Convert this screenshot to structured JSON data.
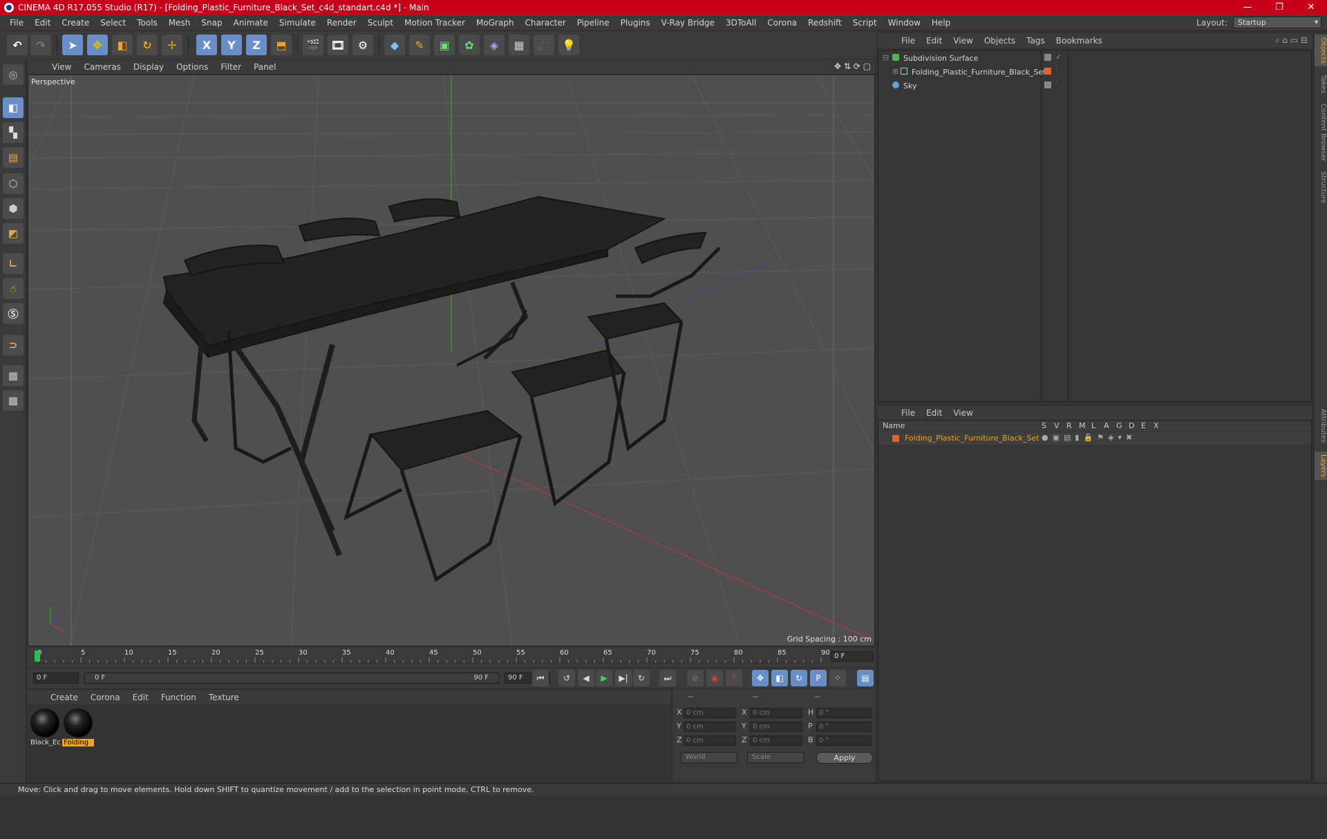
{
  "window": {
    "title": "CINEMA 4D R17.055 Studio (R17) - [Folding_Plastic_Furniture_Black_Set_c4d_standart.c4d *] - Main",
    "controls": [
      "—",
      "❐",
      "✕"
    ]
  },
  "menubar": {
    "items": [
      "File",
      "Edit",
      "Create",
      "Select",
      "Tools",
      "Mesh",
      "Snap",
      "Animate",
      "Simulate",
      "Render",
      "Sculpt",
      "Motion Tracker",
      "MoGraph",
      "Character",
      "Pipeline",
      "Plugins",
      "V-Ray Bridge",
      "3DToAll",
      "Corona",
      "Redshift",
      "Script",
      "Window",
      "Help"
    ],
    "layout_label": "Layout:",
    "layout_value": "Startup"
  },
  "toolbar": {
    "axis_x": "X",
    "axis_y": "Y",
    "axis_z": "Z"
  },
  "viewport": {
    "menu": [
      "View",
      "Cameras",
      "Display",
      "Options",
      "Filter",
      "Panel"
    ],
    "camera_label": "Perspective",
    "grid_spacing": "Grid Spacing : 100 cm"
  },
  "timeline": {
    "ticks": [
      "0",
      "5",
      "10",
      "15",
      "20",
      "25",
      "30",
      "35",
      "40",
      "45",
      "50",
      "55",
      "60",
      "65",
      "70",
      "75",
      "80",
      "85",
      "90"
    ],
    "current_frame": "0 F",
    "start_field": "0 F",
    "slider_start": "0 F",
    "slider_end": "90 F",
    "end_field": "90 F"
  },
  "materials": {
    "menu": [
      "Create",
      "Corona",
      "Edit",
      "Function",
      "Texture"
    ],
    "items": [
      {
        "label": "Black_Ec",
        "selected": false
      },
      {
        "label": "Folding",
        "selected": true
      }
    ]
  },
  "coordinates": {
    "headers": [
      "--",
      "--",
      "--"
    ],
    "rows": [
      {
        "a_label": "X",
        "a_val": "0 cm",
        "b_label": "X",
        "b_val": "0 cm",
        "c_label": "H",
        "c_val": "0 °"
      },
      {
        "a_label": "Y",
        "a_val": "0 cm",
        "b_label": "Y",
        "b_val": "0 cm",
        "c_label": "P",
        "c_val": "0 °"
      },
      {
        "a_label": "Z",
        "a_val": "0 cm",
        "b_label": "Z",
        "b_val": "0 cm",
        "c_label": "B",
        "c_val": "0 °"
      }
    ],
    "mode_select": "World",
    "scale_select": "Scale",
    "apply_label": "Apply"
  },
  "objects": {
    "menu": [
      "File",
      "Edit",
      "View",
      "Objects",
      "Tags",
      "Bookmarks"
    ],
    "items": [
      {
        "name": "Subdivision Surface",
        "indent": 0
      },
      {
        "name": "Folding_Plastic_Furniture_Black_Set",
        "indent": 1
      },
      {
        "name": "Sky",
        "indent": 0
      }
    ]
  },
  "layers": {
    "menu": [
      "File",
      "Edit",
      "View"
    ],
    "columns": [
      "Name",
      "S",
      "V",
      "R",
      "M",
      "L",
      "A",
      "G",
      "D",
      "E",
      "X"
    ],
    "row_name": "Folding_Plastic_Furniture_Black_Set",
    "row_color": "#e0622c"
  },
  "right_tabs": [
    "Objects",
    "Takes",
    "Content Browser",
    "Structure",
    "Attributes",
    "Layers"
  ],
  "status": "Move: Click and drag to move elements. Hold down SHIFT to quantize movement / add to the selection in point mode, CTRL to remove.",
  "colors": {
    "titlebar": "#c8001a",
    "accent_blue": "#6a8fc8",
    "selected_orange": "#f2a21b"
  }
}
